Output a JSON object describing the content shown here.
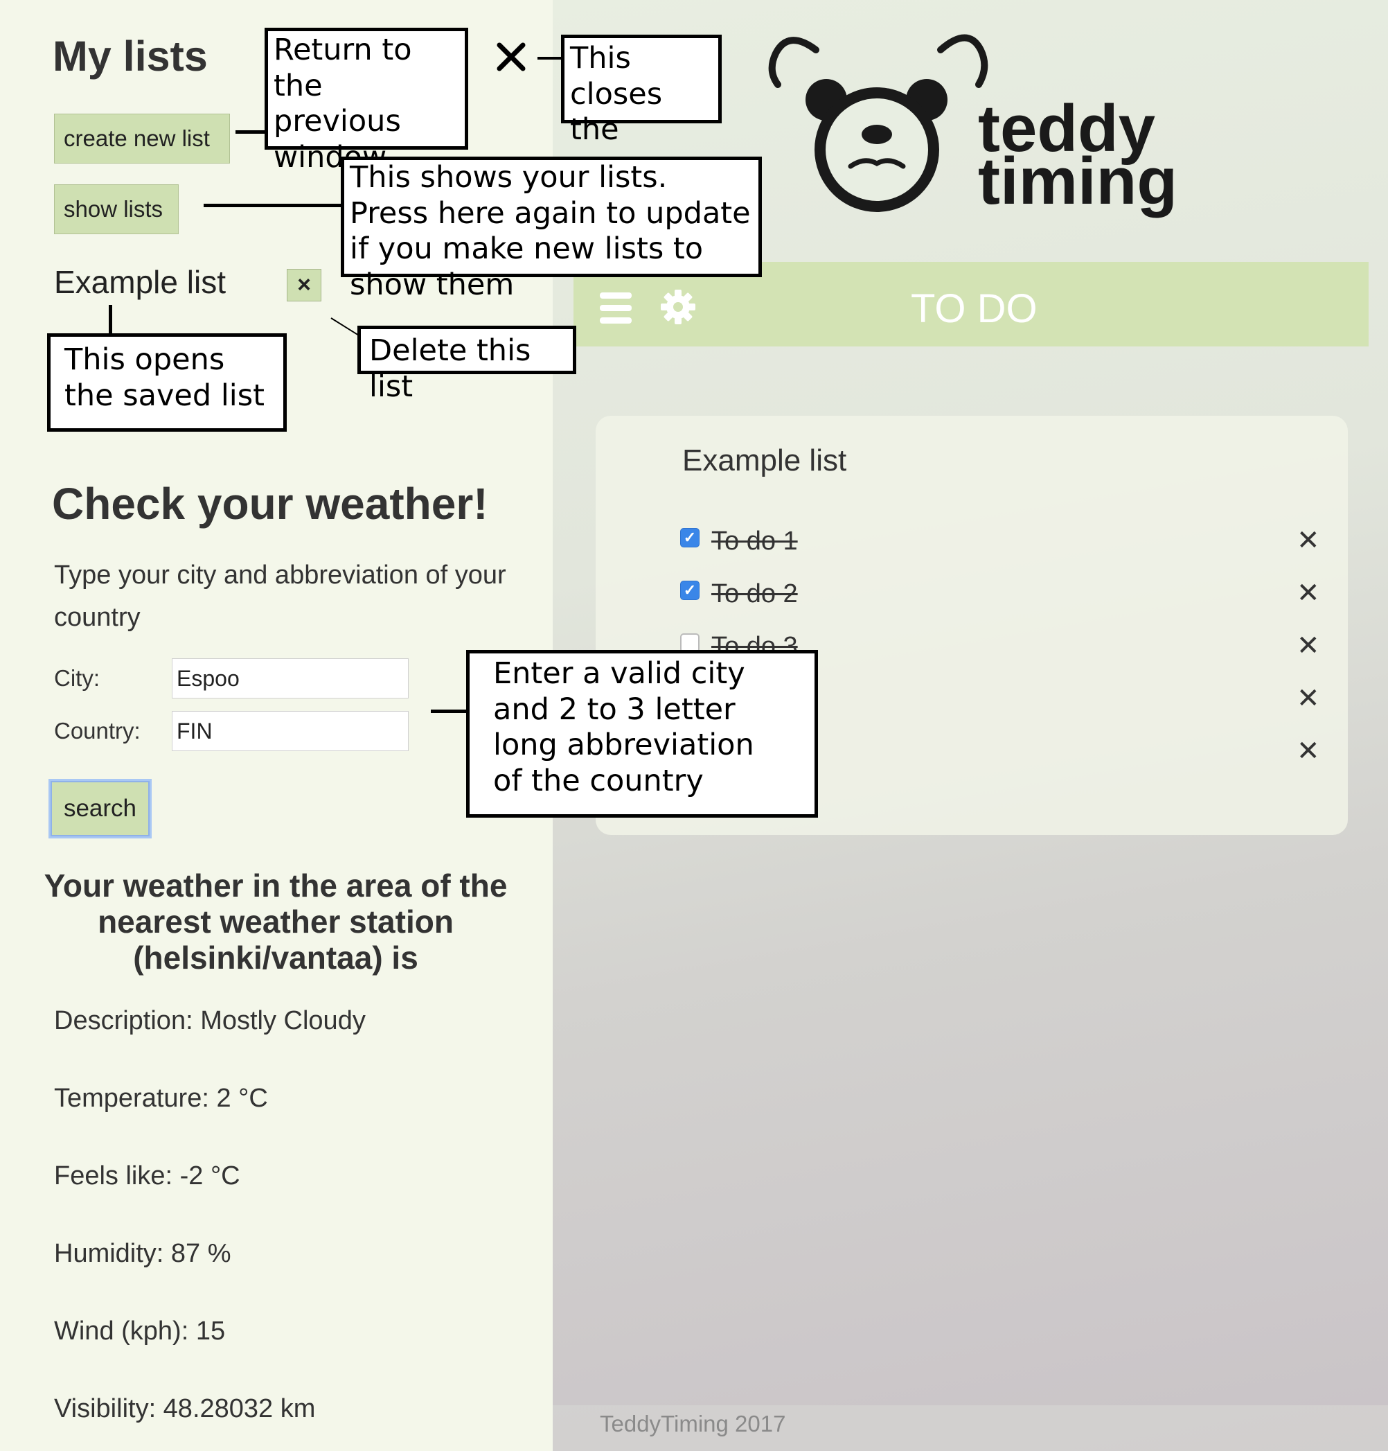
{
  "sidebar": {
    "title": "My lists",
    "create_btn": "create new list",
    "show_btn": "show lists",
    "list_name": "Example list",
    "delete_x": "×"
  },
  "weather": {
    "title": "Check your weather!",
    "subtitle": "Type your city and abbreviation of your country",
    "city_label": "City:",
    "city_value": "Espoo",
    "country_label": "Country:",
    "country_value": "FIN",
    "search_btn": "search",
    "result_heading": "Your weather in the area of the nearest weather station (helsinki/vantaa) is",
    "lines": [
      "Description: Mostly Cloudy",
      "Temperature: 2 °C",
      "Feels like: -2 °C",
      "Humidity: 87 %",
      "Wind (kph): 15",
      "Visibility: 48.28032 km"
    ]
  },
  "header": {
    "logo_line1": "teddy",
    "logo_line2": "timing",
    "bar_title": "TO DO"
  },
  "list": {
    "title": "Example list",
    "items": [
      {
        "label": "To do 1",
        "checked": true
      },
      {
        "label": "To do 2",
        "checked": true
      },
      {
        "label": "To do 3",
        "checked": false
      }
    ],
    "remove_x": "✕"
  },
  "footer": {
    "text": "TeddyTiming 2017"
  },
  "annotations": {
    "return": "Return to the previous window",
    "closes": "This closes the menu",
    "shows": "This shows your lists. Press here again to update if you make new lists to show them",
    "opens": "This opens the saved list",
    "delete": "Delete this list",
    "enter": "Enter a valid city and 2 to 3 letter long abbreviation of the country"
  }
}
